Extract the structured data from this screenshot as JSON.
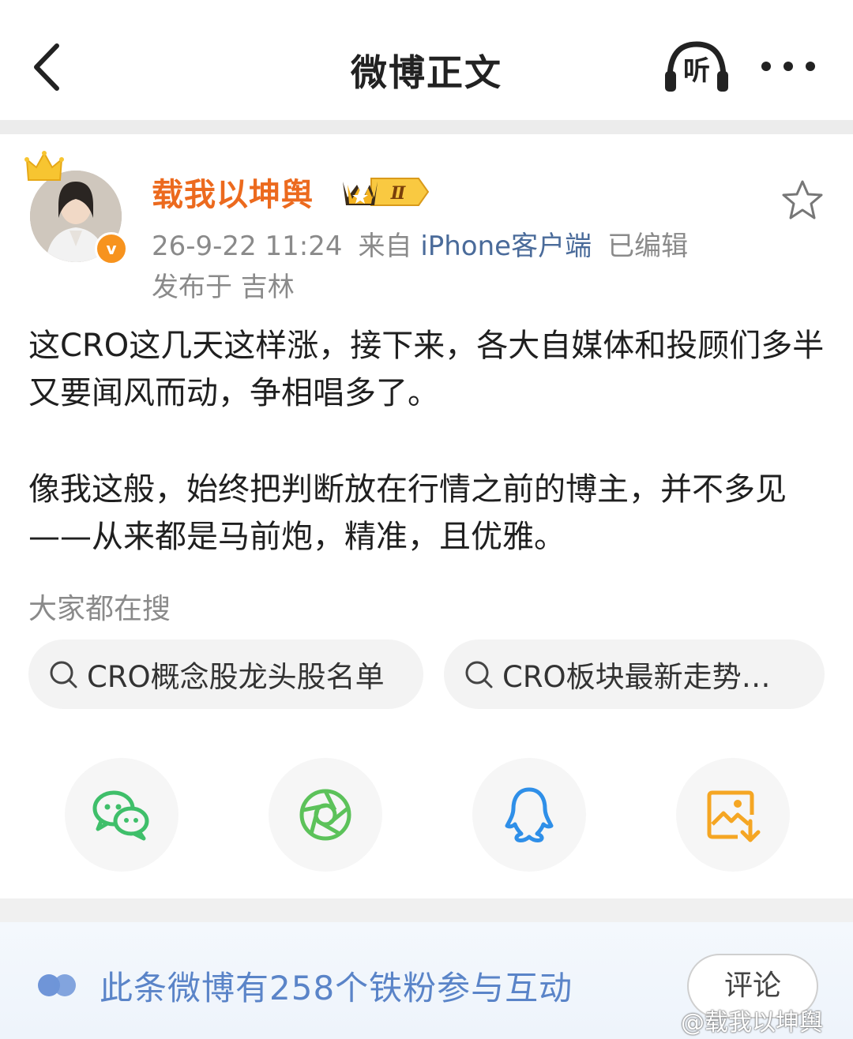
{
  "header": {
    "title": "微博正文",
    "listen_label": "听"
  },
  "author": {
    "name": "载我以坤舆",
    "vip_level": "Ⅱ",
    "verified_mark": "v",
    "timestamp": "26-9-22 11:24",
    "source_prefix": "来自",
    "source": "iPhone客户端",
    "edited": "已编辑",
    "location": "发布于 吉林"
  },
  "post": {
    "paragraphs": [
      "这CRO这几天这样涨，接下来，各大自媒体和投顾们多半又要闻风而动，争相唱多了。",
      "像我这般，始终把判断放在行情之前的博主，并不多见——从来都是马前炮，精准，且优雅。"
    ]
  },
  "search": {
    "hint": "大家都在搜",
    "chips": [
      "CRO概念股龙头股名单",
      "CRO板块最新走势…"
    ]
  },
  "share": {
    "icons": [
      "wechat-icon",
      "moments-icon",
      "qq-icon",
      "save-image-icon"
    ],
    "colors": {
      "wechat": "#3fbf6a",
      "moments": "#5cc25a",
      "qq": "#2f8fe8",
      "save": "#f5a623"
    }
  },
  "footer": {
    "fans_text": "此条微博有258个铁粉参与互动",
    "comment_label": "评论",
    "watermark": "@载我以坤舆"
  },
  "colors": {
    "username": "#ec6a1e",
    "link": "#4a6b9a",
    "fans_text": "#5a84c8"
  }
}
